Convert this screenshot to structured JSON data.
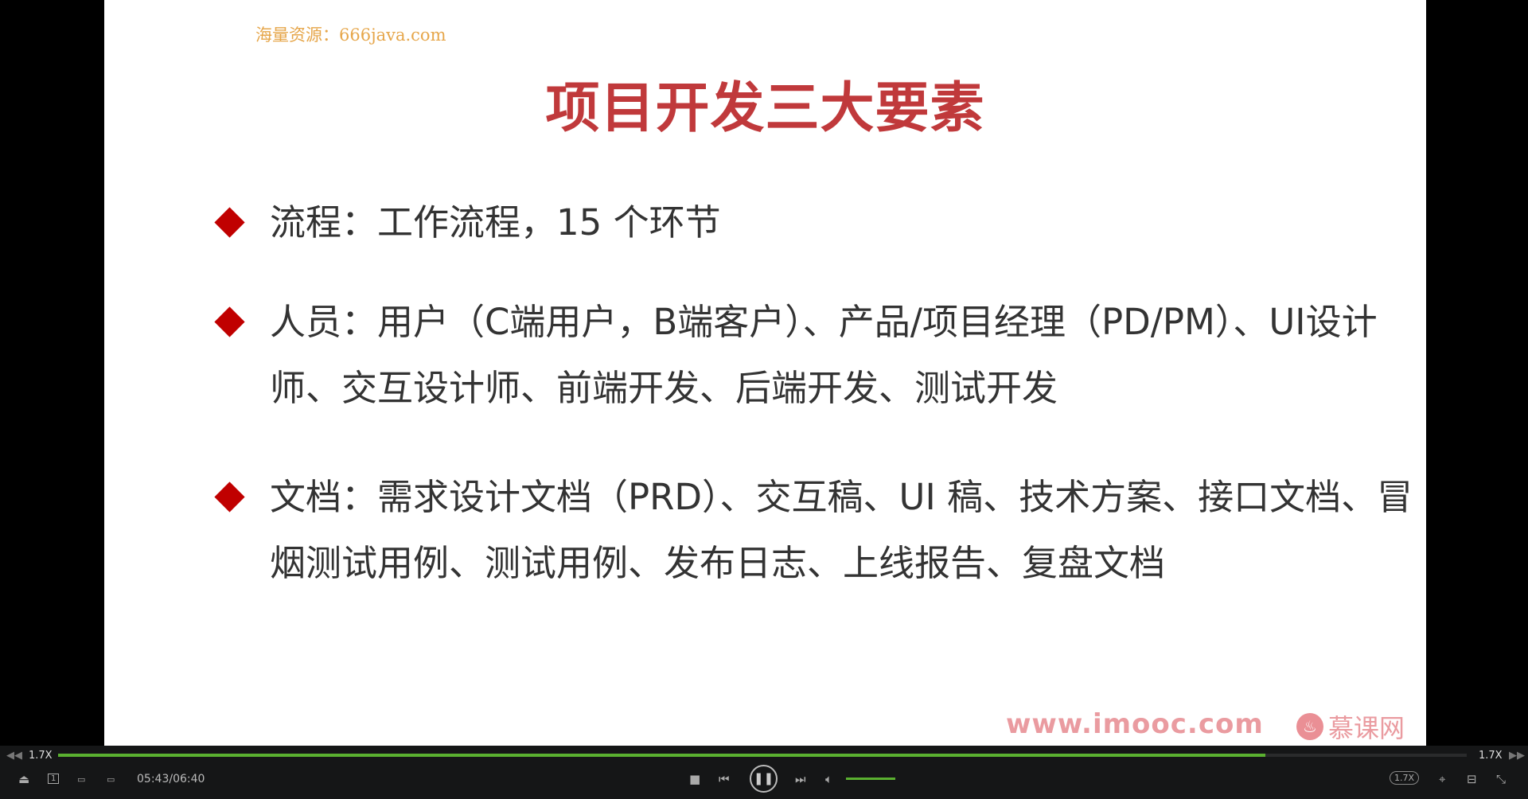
{
  "watermark": "海量资源：666java.com",
  "slide": {
    "title": "项目开发三大要素",
    "bullets": [
      "流程：工作流程，15 个环节",
      "人员：用户（C端用户，B端客户）、产品/项目经理（PD/PM）、UI设计师、交互设计师、前端开发、后端开发、测试开发",
      "文档：需求设计文档（PRD）、交互稿、UI 稿、技术方案、接口文档、冒烟测试用例、测试用例、发布日志、上线报告、复盘文档"
    ],
    "footer_url": "www.imooc.com",
    "footer_brand": "慕课网"
  },
  "player": {
    "rate_left": "1.7X",
    "rate_right": "1.7X",
    "rate_badge": "1.7X",
    "time": "05:43/06:40",
    "progress": 0.857,
    "volume": 1.0,
    "colors": {
      "accent": "#5ab030",
      "title": "#c0393b",
      "bullet": "#c00000"
    }
  }
}
